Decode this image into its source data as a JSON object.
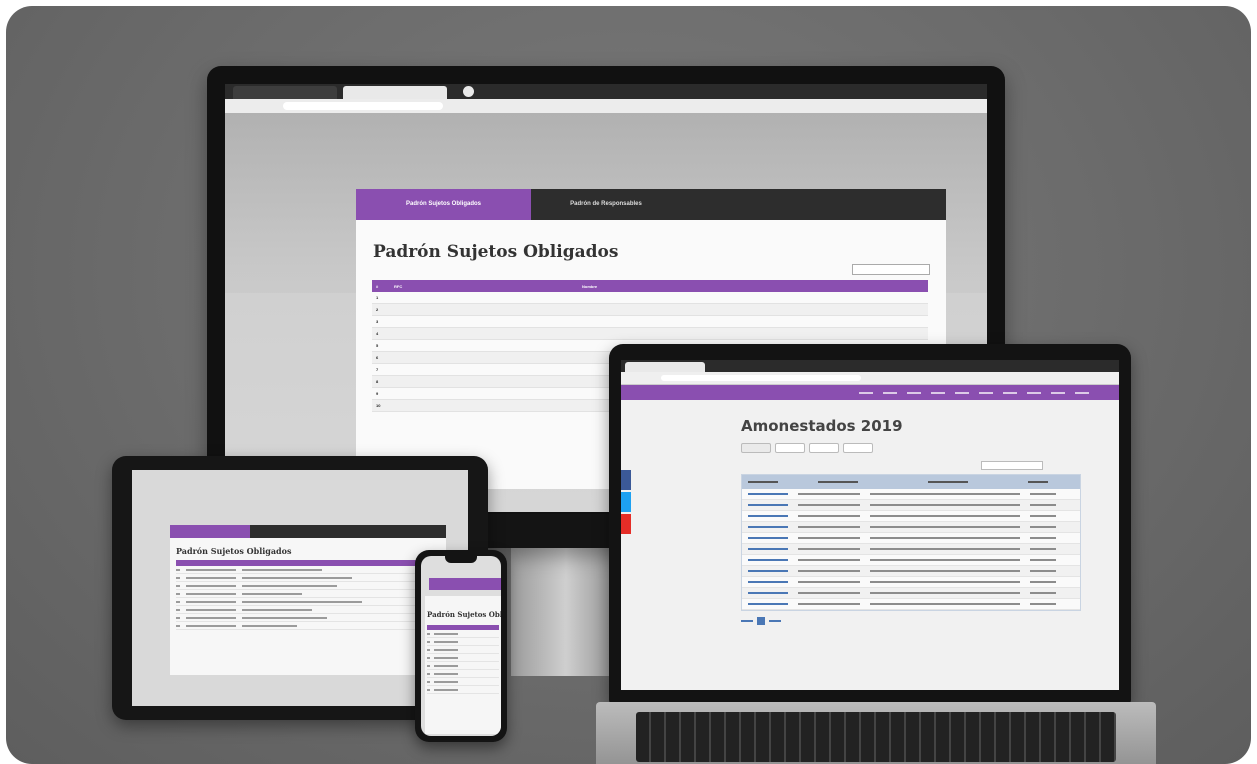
{
  "desktop": {
    "tabs": [
      {
        "label": "Padrón Sujetos Obligados"
      },
      {
        "label": "Padrón de Responsables"
      }
    ],
    "page_title": "Padrón Sujetos Obligados",
    "table_headers": [
      "#",
      "RFC",
      "Nombre"
    ],
    "rows": [
      {
        "n": "1",
        "rfc": "",
        "name": ""
      },
      {
        "n": "2",
        "rfc": "",
        "name": ""
      },
      {
        "n": "3",
        "rfc": "",
        "name": ""
      },
      {
        "n": "4",
        "rfc": "",
        "name": ""
      },
      {
        "n": "5",
        "rfc": "",
        "name": ""
      },
      {
        "n": "6",
        "rfc": "",
        "name": ""
      },
      {
        "n": "7",
        "rfc": "",
        "name": ""
      },
      {
        "n": "8",
        "rfc": "",
        "name": ""
      },
      {
        "n": "9",
        "rfc": "",
        "name": ""
      },
      {
        "n": "10",
        "rfc": "",
        "name": ""
      }
    ]
  },
  "tablet": {
    "page_title": "Padrón Sujetos Obligados"
  },
  "phone": {
    "page_title": "Padrón Sujetos Obli"
  },
  "laptop": {
    "page_title": "Amonestados 2019"
  },
  "colors": {
    "accent": "#8a4fb0",
    "table_header_blue": "#b9c8dc",
    "link": "#4a77b5",
    "background": "#6b6b6b"
  }
}
